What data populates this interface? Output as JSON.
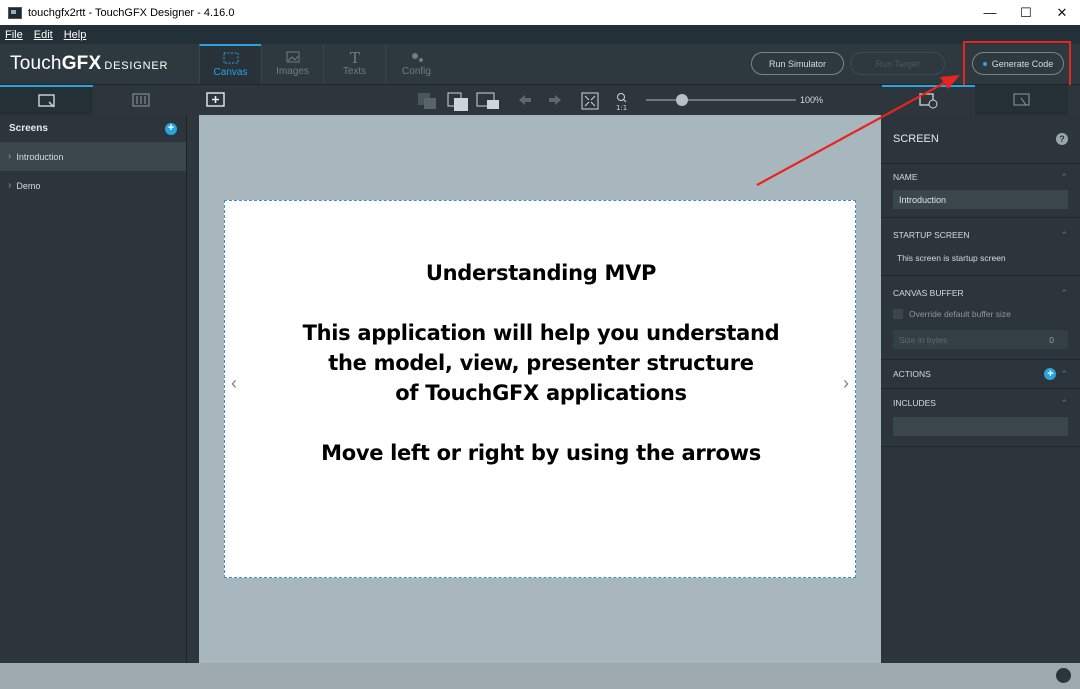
{
  "window": {
    "title": "touchgfx2rtt - TouchGFX Designer - 4.16.0",
    "controls": [
      "—",
      "☐",
      "✕"
    ]
  },
  "menu": [
    "File",
    "Edit",
    "Help"
  ],
  "logo": {
    "brand_light": "Touch",
    "brand_bold": "GFX",
    "suffix": "DESIGNER"
  },
  "nav_tabs": [
    {
      "label": "Canvas",
      "icon": "canvas-icon",
      "active": true
    },
    {
      "label": "Images",
      "icon": "images-icon",
      "active": false
    },
    {
      "label": "Texts",
      "icon": "texts-icon",
      "active": false
    },
    {
      "label": "Config",
      "icon": "config-icon",
      "active": false
    }
  ],
  "actions": {
    "run_simulator": "Run Simulator",
    "run_target": "Run Target",
    "generate_code": "Generate Code"
  },
  "canvas_toolbar": {
    "zoom": "100%"
  },
  "screens_panel": {
    "title": "Screens",
    "items": [
      {
        "label": "Introduction",
        "selected": true
      },
      {
        "label": "Demo",
        "selected": false
      }
    ]
  },
  "artboard": {
    "lines": [
      "Understanding MVP",
      "This application will help you understand",
      "the model, view, presenter structure",
      "of TouchGFX applications",
      "Move left or right by using the arrows"
    ]
  },
  "properties": {
    "title": "SCREEN",
    "name_label": "NAME",
    "name_value": "Introduction",
    "startup_label": "STARTUP SCREEN",
    "startup_text": "This screen is startup screen",
    "buffer_label": "CANVAS BUFFER",
    "buffer_checkbox": "Override default buffer size",
    "buffer_size_placeholder": "Size in bytes",
    "buffer_size_value": "0",
    "actions_label": "ACTIONS",
    "includes_label": "INCLUDES"
  },
  "colors": {
    "accent": "#2aa3e0",
    "highlight": "#e8241f"
  }
}
